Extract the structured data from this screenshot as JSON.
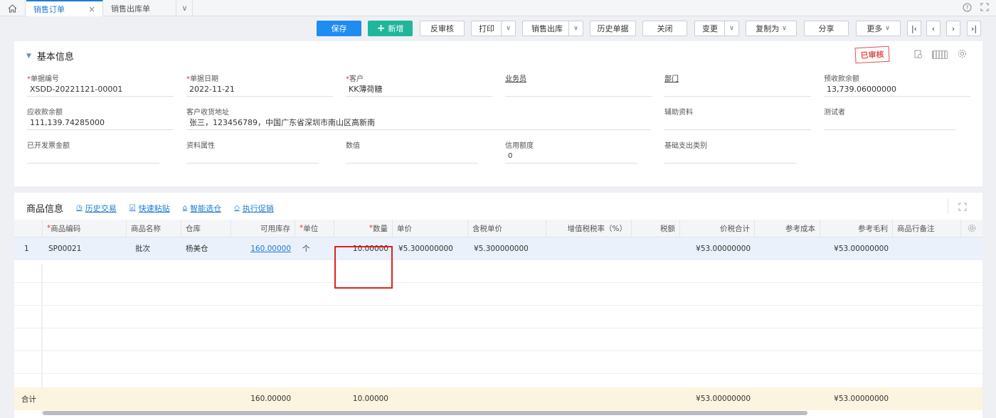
{
  "tabs": {
    "home_icon": "home-icon",
    "items": [
      {
        "label": "销售订单",
        "active": true
      },
      {
        "label": "销售出库单",
        "active": false
      }
    ],
    "close_glyph": "×",
    "more_glyph": "∨",
    "help_glyph": "?",
    "fullscreen_glyph": "⛶"
  },
  "toolbar": {
    "save": "保存",
    "add": "新增",
    "add_glyph": "+",
    "unaudit": "反审核",
    "print": "打印",
    "sales_out": "销售出库",
    "history": "历史单据",
    "close": "关闭",
    "change": "变更",
    "copy_as": "复制为",
    "share": "分享",
    "more": "更多",
    "nav_first": "|‹",
    "nav_prev": "‹",
    "nav_next": "›",
    "nav_last": "›|",
    "dd_glyph": "∨"
  },
  "basic": {
    "title": "基本信息",
    "stamp": "已审核",
    "fields": {
      "doc_no": {
        "label": "单据编号",
        "value": "XSDD-20221121-00001"
      },
      "doc_date": {
        "label": "单据日期",
        "value": "2022-11-21"
      },
      "customer": {
        "label": "客户",
        "value": "KK薄荷糖"
      },
      "salesman": {
        "label": "业务员",
        "value": ""
      },
      "dept": {
        "label": "部门",
        "value": ""
      },
      "prepay_balance": {
        "label": "预收款余额",
        "value": "13,739.06000000"
      },
      "receivable_balance": {
        "label": "应收款余额",
        "value": "111,139.74285000"
      },
      "address": {
        "label": "客户收货地址",
        "value": "张三，123456789，中国广东省深圳市南山区高新南"
      },
      "aux": {
        "label": "辅助资料",
        "value": ""
      },
      "tester": {
        "label": "测试者",
        "value": ""
      },
      "invoiced": {
        "label": "已开发票金额",
        "value": ""
      },
      "attr": {
        "label": "资料属性",
        "value": ""
      },
      "numeric": {
        "label": "数值",
        "value": ""
      },
      "credit": {
        "label": "信用额度",
        "value": "0"
      },
      "expense_type": {
        "label": "基础支出类别",
        "value": ""
      }
    }
  },
  "products": {
    "title": "商品信息",
    "links": {
      "history": "历史交易",
      "paste": "快速粘贴",
      "smart": "智能选仓",
      "promo": "执行促销"
    },
    "columns": {
      "code": "商品编码",
      "name": "商品名称",
      "warehouse": "仓库",
      "stock": "可用库存",
      "unit": "单位",
      "qty": "数量",
      "price": "单价",
      "tax_price": "含税单价",
      "tax_rate": "增值税税率（%）",
      "tax": "税额",
      "total": "价税合计",
      "ref_cost": "参考成本",
      "ref_profit": "参考毛利",
      "remark": "商品行备注"
    },
    "rows": [
      {
        "num": "1",
        "code": "SP00021",
        "name": "批次",
        "warehouse": "杨美仓",
        "stock": "160.00000",
        "unit": "个",
        "qty": "10.00000",
        "price": "¥5.300000000",
        "tax_price": "¥5.300000000",
        "tax_rate": "",
        "tax": "",
        "total": "¥53.00000000",
        "ref_cost": "",
        "ref_profit": "¥53.00000000",
        "remark": ""
      }
    ],
    "totals": {
      "label": "合计",
      "stock": "160.00000",
      "qty": "10.00000",
      "total": "¥53.00000000",
      "ref_profit": "¥53.00000000"
    }
  }
}
